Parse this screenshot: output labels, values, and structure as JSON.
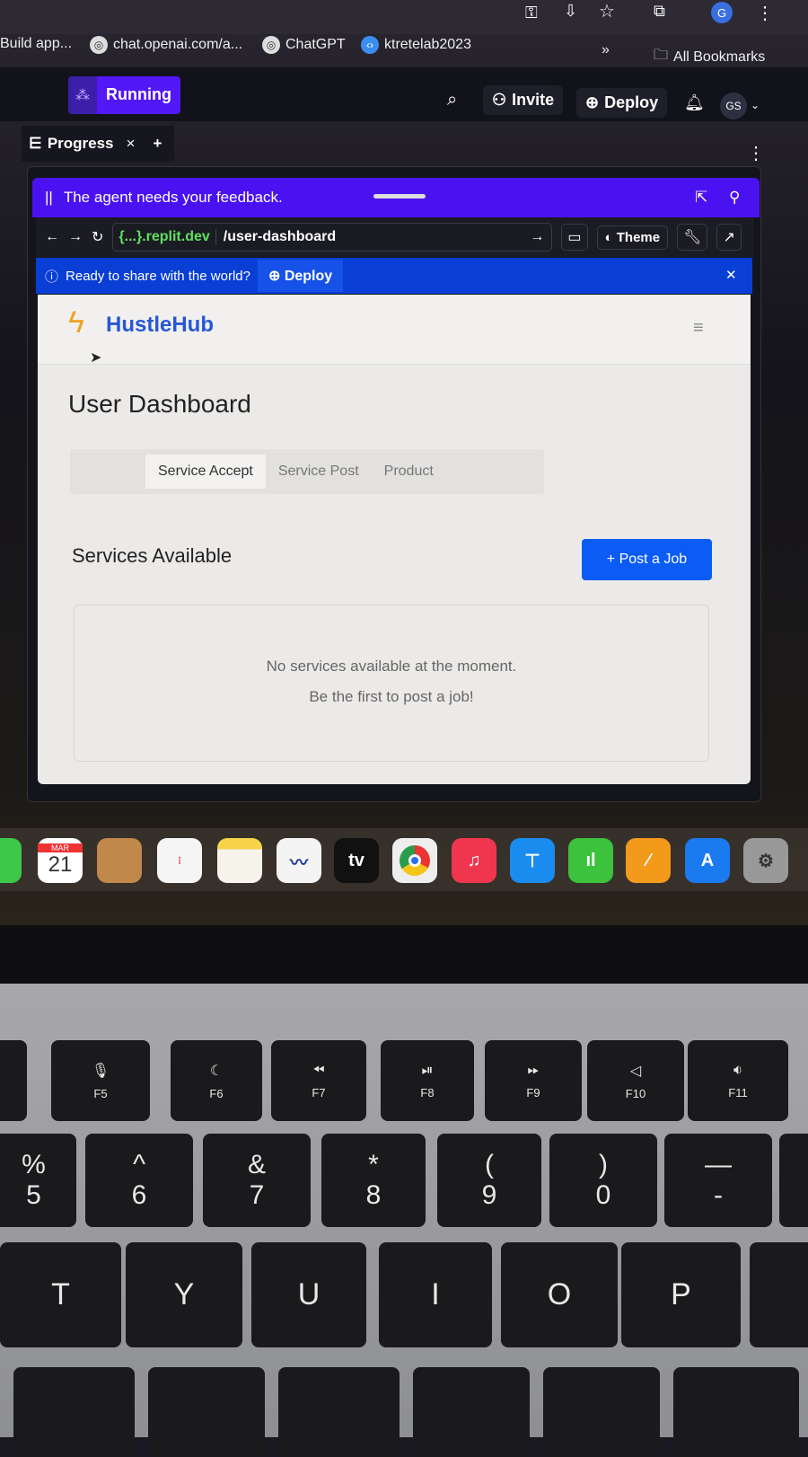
{
  "browser": {
    "profile_initial": "G",
    "bookmarks": [
      "Build app...",
      "chat.openai.com/a...",
      "ChatGPT",
      "ktretelab2023"
    ],
    "more": "»",
    "all_bookmarks": "All Bookmarks"
  },
  "replit": {
    "status": "Running",
    "invite": "Invite",
    "deploy": "Deploy",
    "user_initials": "GS",
    "tab": "Progress",
    "tab_add": "+"
  },
  "feedback": {
    "text": "The agent needs your feedback."
  },
  "urlbar": {
    "domain": "{...}.replit.dev",
    "path": "/user-dashboard",
    "theme": "Theme"
  },
  "banner": {
    "text": "Ready to share with the world?",
    "deploy": "Deploy"
  },
  "app": {
    "brand": "HustleHub",
    "title": "User Dashboard",
    "tabs": [
      {
        "label": "Service Accept",
        "active": true
      },
      {
        "label": "Service Post",
        "active": false
      },
      {
        "label": "Product",
        "active": false
      }
    ],
    "section_title": "Services Available",
    "post_button": "+ Post a Job",
    "empty_line1": "No services available at the moment.",
    "empty_line2": "Be the first to post a job!",
    "colors": {
      "primary": "#0a5cf5",
      "brand": "#2857d6",
      "feedback": "#4a12f0"
    }
  },
  "dock": {
    "calendar_month": "MAR",
    "calendar_day": "21",
    "tv": "tv"
  },
  "keyboard": {
    "fn_row": [
      {
        "icon": "microphone-icon",
        "label": "F5"
      },
      {
        "icon": "moon-icon",
        "label": "F6"
      },
      {
        "icon": "rewind-icon",
        "label": "F7"
      },
      {
        "icon": "play-pause-icon",
        "label": "F8"
      },
      {
        "icon": "fast-forward-icon",
        "label": "F9"
      },
      {
        "icon": "volume-mute-icon",
        "label": "F10"
      },
      {
        "icon": "volume-down-icon",
        "label": "F11"
      }
    ],
    "num_row": [
      {
        "top": "%",
        "bottom": "5"
      },
      {
        "top": "^",
        "bottom": "6"
      },
      {
        "top": "&",
        "bottom": "7"
      },
      {
        "top": "*",
        "bottom": "8"
      },
      {
        "top": "(",
        "bottom": "9"
      },
      {
        "top": ")",
        "bottom": "0"
      },
      {
        "top": "—",
        "bottom": "-"
      }
    ],
    "letter_row": [
      "T",
      "Y",
      "U",
      "I",
      "O",
      "P"
    ]
  }
}
